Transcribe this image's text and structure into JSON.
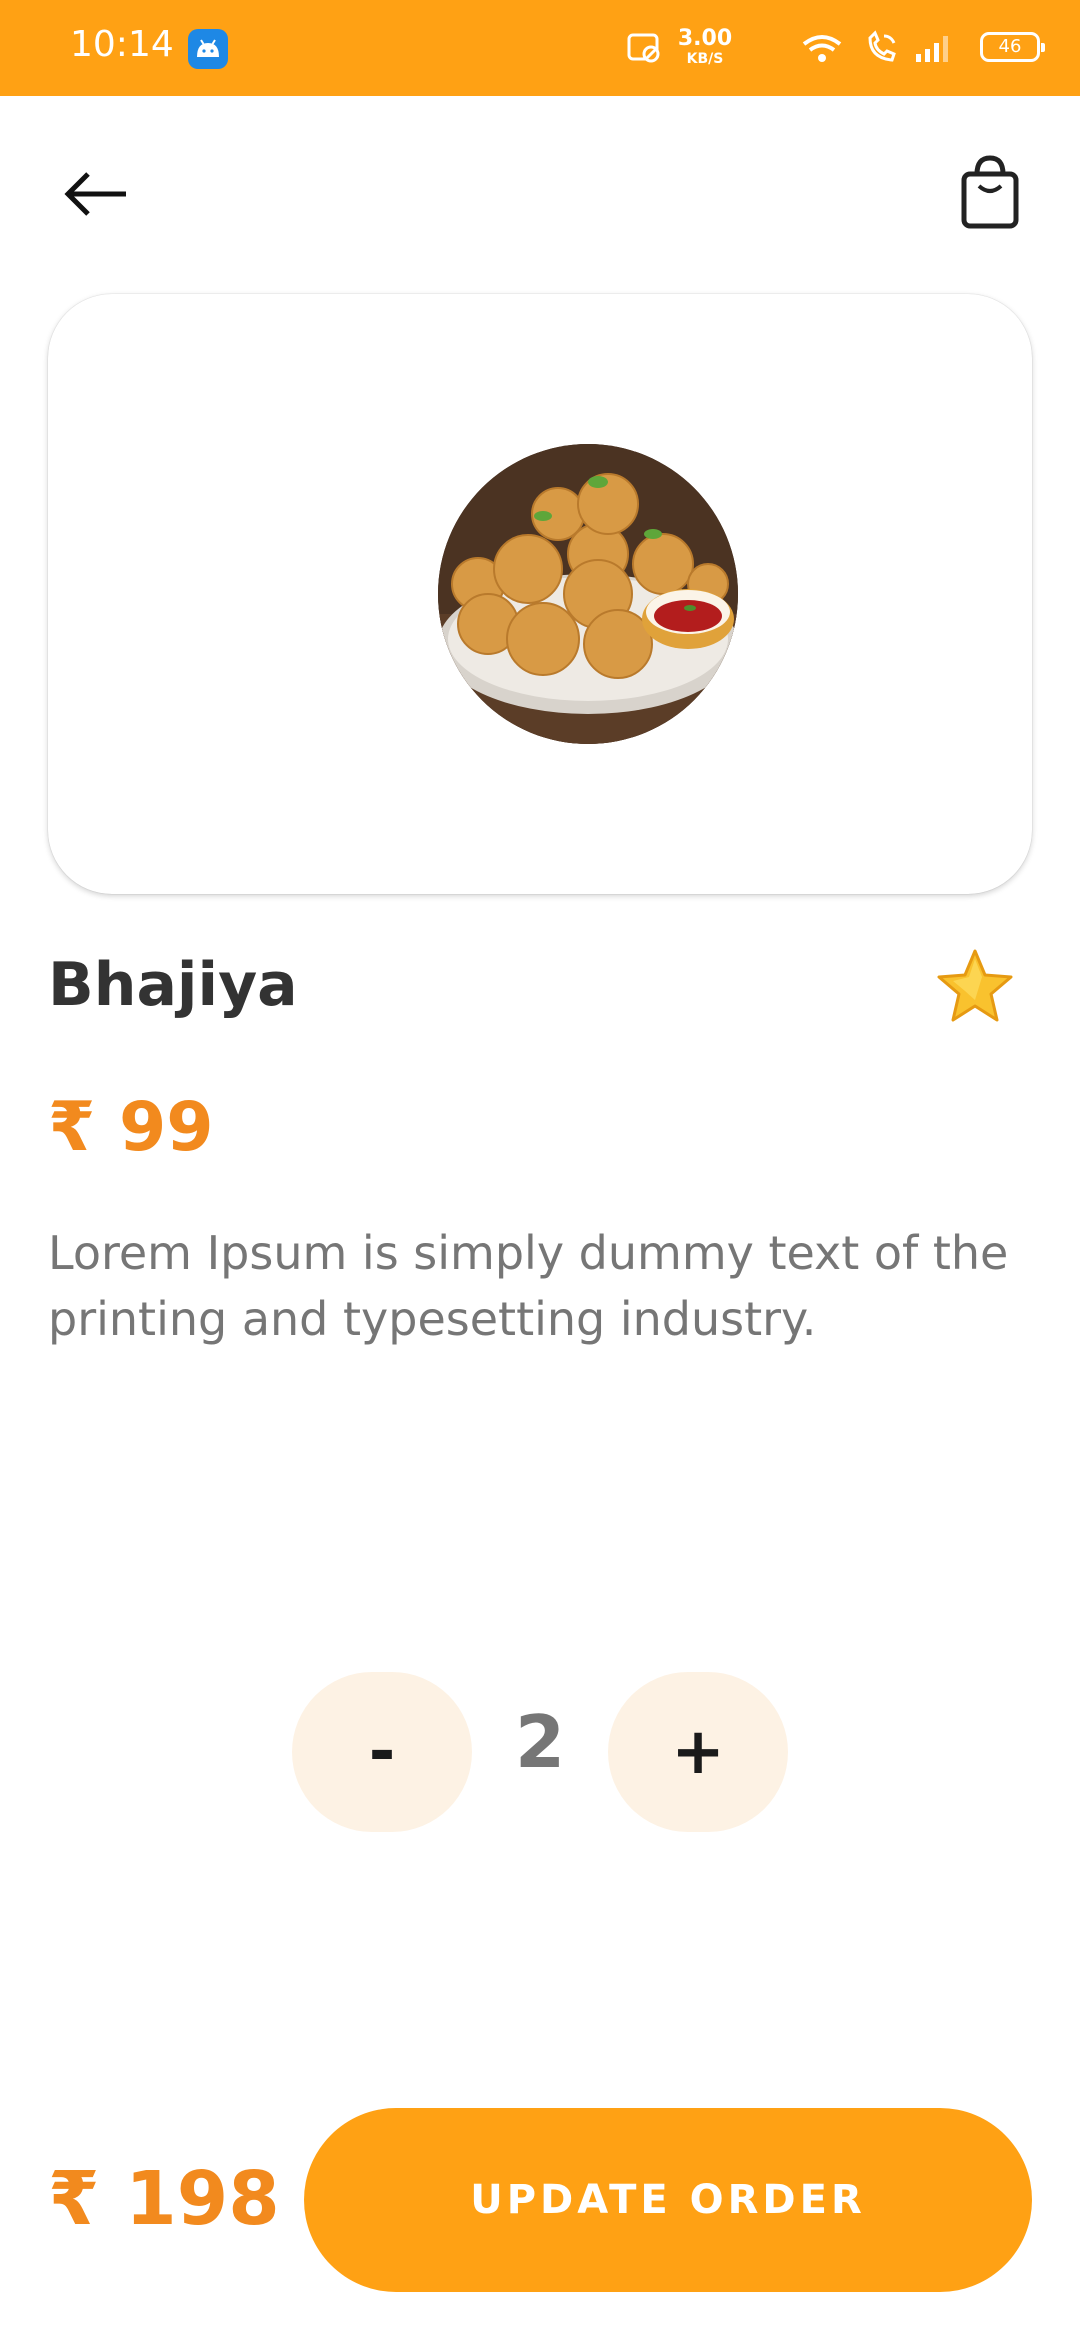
{
  "status_bar": {
    "time": "10:14",
    "net_speed_value": "3.00",
    "net_speed_unit": "KB/S",
    "battery": "46",
    "icons": [
      "android-app-icon",
      "no-sim-icon",
      "wifi-icon",
      "wifi-calling-icon",
      "signal-icon",
      "battery-icon"
    ]
  },
  "nav": {
    "back_icon": "arrow-left-icon",
    "cart_icon": "shopping-bag-icon"
  },
  "product": {
    "image": "bhajiya-plate-photo",
    "name": "Bhajiya",
    "price": "₹ 99",
    "description": "Lorem Ipsum is simply dummy text of the printing and typesetting industry.",
    "favorite_icon": "star-icon"
  },
  "quantity": {
    "minus_label": "-",
    "value": "2",
    "plus_label": "+"
  },
  "footer": {
    "total": "₹ 198",
    "button_label": "UPDATE ORDER"
  },
  "colors": {
    "accent": "#FFA114",
    "price": "#F28A1E",
    "stepper_bg": "#FDF2E4",
    "title": "#333333",
    "body_text": "#767676"
  }
}
